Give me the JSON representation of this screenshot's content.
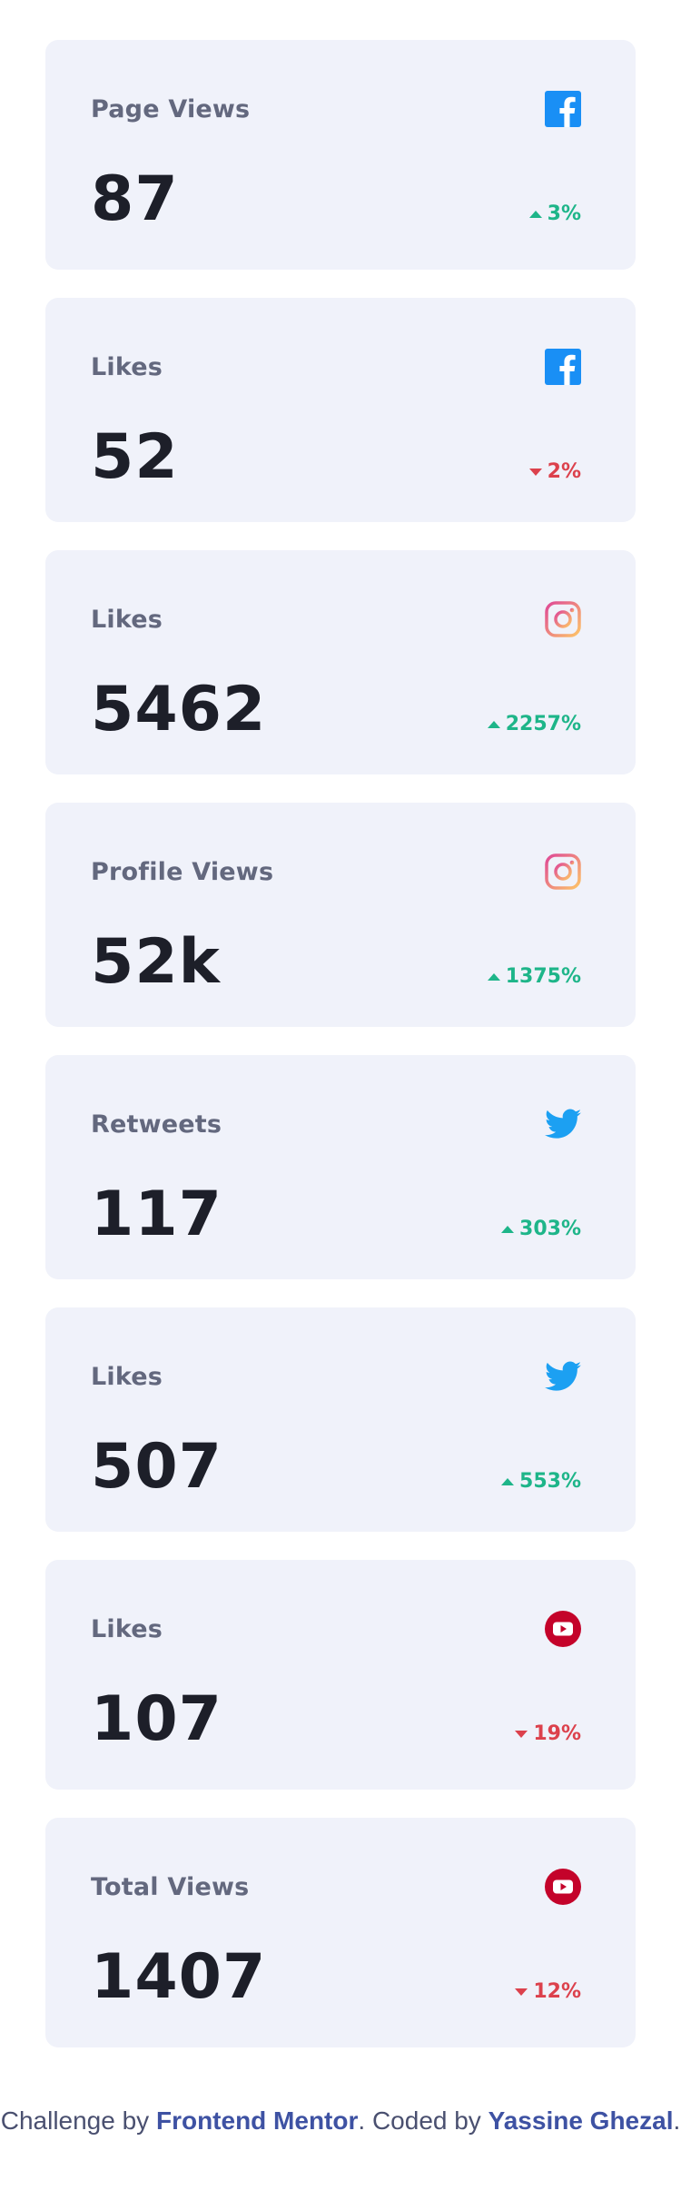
{
  "cards": [
    {
      "label": "Page Views",
      "value": "87",
      "change": "3%",
      "direction": "up",
      "icon": "facebook-icon"
    },
    {
      "label": "Likes",
      "value": "52",
      "change": "2%",
      "direction": "down",
      "icon": "facebook-icon"
    },
    {
      "label": "Likes",
      "value": "5462",
      "change": "2257%",
      "direction": "up",
      "icon": "instagram-icon"
    },
    {
      "label": "Profile Views",
      "value": "52k",
      "change": "1375%",
      "direction": "up",
      "icon": "instagram-icon"
    },
    {
      "label": "Retweets",
      "value": "117",
      "change": "303%",
      "direction": "up",
      "icon": "twitter-icon"
    },
    {
      "label": "Likes",
      "value": "507",
      "change": "553%",
      "direction": "up",
      "icon": "twitter-icon"
    },
    {
      "label": "Likes",
      "value": "107",
      "change": "19%",
      "direction": "down",
      "icon": "youtube-icon"
    },
    {
      "label": "Total Views",
      "value": "1407",
      "change": "12%",
      "direction": "down",
      "icon": "youtube-icon"
    }
  ],
  "colors": {
    "card_bg": "#f0f2fa",
    "up": "#1eb589",
    "down": "#dc414c",
    "facebook": "#198ff5",
    "twitter": "#1ca0f2",
    "youtube": "#c4032a",
    "link": "#3e52a3"
  },
  "attribution": {
    "prefix": "Challenge by ",
    "link1": "Frontend Mentor",
    "middle": ". Coded by ",
    "link2": "Yassine Ghezal",
    "suffix": "."
  }
}
